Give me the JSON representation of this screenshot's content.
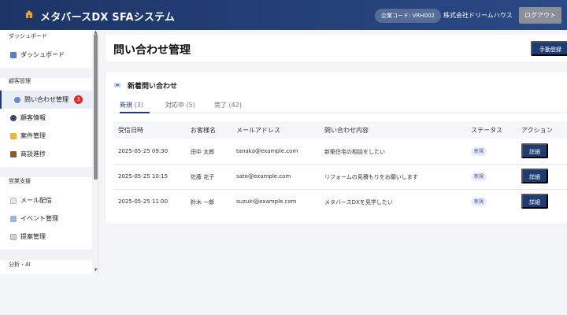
{
  "header": {
    "app_title": "メタバースDX SFAシステム",
    "company_code": "企業コード: VRH002",
    "company_name": "株式会社ドリームハウス",
    "logout_label": "ログアウト"
  },
  "sidebar": {
    "sections": [
      {
        "label": "ダッシュボード"
      },
      {
        "label": "顧客管理"
      },
      {
        "label": "営業支援"
      },
      {
        "label": "分析・AI"
      }
    ],
    "items": [
      {
        "label": "ダッシュボード"
      },
      {
        "label": "問い合わせ管理",
        "badge": "3",
        "active": true
      },
      {
        "label": "顧客情報"
      },
      {
        "label": "案件管理"
      },
      {
        "label": "商談進捗"
      },
      {
        "label": "メール配信"
      },
      {
        "label": "イベント管理"
      },
      {
        "label": "提案管理"
      }
    ]
  },
  "page": {
    "title": "問い合わせ管理",
    "manual_register_label": "手動登録"
  },
  "card": {
    "title": "新着問い合わせ",
    "tabs": [
      {
        "label": "新規",
        "count": "(3)",
        "active": true
      },
      {
        "label": "対応中",
        "count": "(5)"
      },
      {
        "label": "完了",
        "count": "(42)"
      }
    ],
    "columns": [
      "受信日時",
      "お客様名",
      "メールアドレス",
      "問い合わせ内容",
      "ステータス",
      "アクション"
    ],
    "rows": [
      {
        "date": "2025-05-25 09:30",
        "name": "田中 太郎",
        "email": "tanaka@example.com",
        "content": "新築住宅の相談をしたい",
        "status": "新規",
        "action": "詳細"
      },
      {
        "date": "2025-05-25 10:15",
        "name": "佐藤 花子",
        "email": "sato@example.com",
        "content": "リフォームの見積もりをお願いします",
        "status": "新規",
        "action": "詳細"
      },
      {
        "date": "2025-05-25 11:00",
        "name": "鈴木 一郎",
        "email": "suzuki@example.com",
        "content": "メタバースDXを見学したい",
        "status": "新規",
        "action": "詳細"
      }
    ]
  },
  "colors": {
    "primary": "#1f3b73",
    "header_bg": "#1d3566",
    "badge_red": "#dc2f2f",
    "logout_gray": "#8a8f98"
  }
}
